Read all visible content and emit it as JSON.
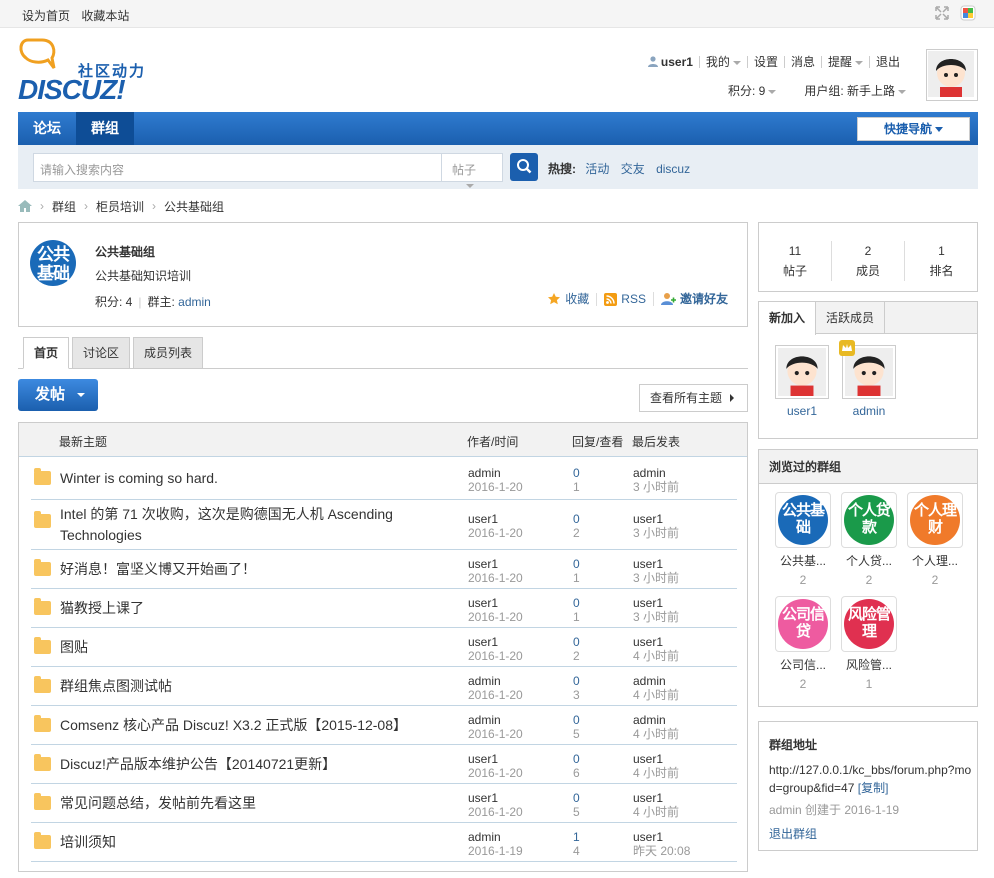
{
  "topbar": {
    "set_home": "设为首页",
    "bookmark": "收藏本站"
  },
  "logo": {
    "tagline": "社区动力",
    "brand": "DISCUZ!"
  },
  "user": {
    "name": "user1",
    "mine": "我的",
    "settings": "设置",
    "messages": "消息",
    "remind": "提醒",
    "logout": "退出",
    "points": "积分: 9",
    "usergroup": "用户组: 新手上路"
  },
  "nav": {
    "forum": "论坛",
    "group": "群组",
    "quick": "快捷导航"
  },
  "search": {
    "placeholder": "请输入搜索内容",
    "type": "帖子",
    "hot_label": "热搜:",
    "hot": [
      "活动",
      "交友",
      "discuz"
    ]
  },
  "breadcrumb": [
    "群组",
    "柜员培训",
    "公共基础组"
  ],
  "group": {
    "icon_text": "公共基础",
    "name": "公共基础组",
    "desc": "公共基础知识培训",
    "points_label": "积分: 4",
    "owner_label": "群主:",
    "owner": "admin",
    "fav": "收藏",
    "rss": "RSS",
    "invite": "邀请好友"
  },
  "tabs": [
    "首页",
    "讨论区",
    "成员列表"
  ],
  "actions": {
    "post": "发帖",
    "view_all": "查看所有主题"
  },
  "table": {
    "headers": [
      "最新主题",
      "作者/时间",
      "回复/查看",
      "最后发表"
    ],
    "rows": [
      {
        "title": "Winter is coming so hard.",
        "author": "admin",
        "date": "2016-1-20",
        "replies": "0",
        "views": "1",
        "last_user": "admin",
        "last_time": "3 小时前"
      },
      {
        "title": "Intel 的第 71 次收购，这次是购德国无人机 Ascending Technologies",
        "author": "user1",
        "date": "2016-1-20",
        "replies": "0",
        "views": "2",
        "last_user": "user1",
        "last_time": "3 小时前"
      },
      {
        "title": "好消息！富坚义博又开始画了！",
        "author": "user1",
        "date": "2016-1-20",
        "replies": "0",
        "views": "1",
        "last_user": "user1",
        "last_time": "3 小时前"
      },
      {
        "title": "猫教授上课了",
        "author": "user1",
        "date": "2016-1-20",
        "replies": "0",
        "views": "1",
        "last_user": "user1",
        "last_time": "3 小时前"
      },
      {
        "title": "图贴",
        "author": "user1",
        "date": "2016-1-20",
        "replies": "0",
        "views": "2",
        "last_user": "user1",
        "last_time": "4 小时前"
      },
      {
        "title": "群组焦点图测试帖",
        "author": "admin",
        "date": "2016-1-20",
        "replies": "0",
        "views": "3",
        "last_user": "admin",
        "last_time": "4 小时前"
      },
      {
        "title": "Comsenz 核心产品 Discuz! X3.2 正式版【2015-12-08】",
        "author": "admin",
        "date": "2016-1-20",
        "replies": "0",
        "views": "5",
        "last_user": "admin",
        "last_time": "4 小时前"
      },
      {
        "title": "Discuz!产品版本维护公告【20140721更新】",
        "author": "user1",
        "date": "2016-1-20",
        "replies": "0",
        "views": "6",
        "last_user": "user1",
        "last_time": "4 小时前"
      },
      {
        "title": "常见问题总结，发帖前先看这里",
        "author": "user1",
        "date": "2016-1-20",
        "replies": "0",
        "views": "5",
        "last_user": "user1",
        "last_time": "4 小时前"
      },
      {
        "title": "培训须知",
        "author": "admin",
        "date": "2016-1-19",
        "replies": "1",
        "views": "4",
        "last_user": "user1",
        "last_time": "昨天 20:08"
      }
    ]
  },
  "stats": [
    {
      "num": "11",
      "label": "帖子"
    },
    {
      "num": "2",
      "label": "成员"
    },
    {
      "num": "1",
      "label": "排名"
    }
  ],
  "members": {
    "tab_new": "新加入",
    "tab_active": "活跃成员",
    "list": [
      "user1",
      "admin"
    ]
  },
  "browsed": {
    "title": "浏览过的群组",
    "groups": [
      {
        "icon": "公共基础",
        "name": "公共基...",
        "count": "2",
        "color": "#1a6ab8"
      },
      {
        "icon": "个人贷款",
        "name": "个人贷...",
        "count": "2",
        "color": "#1a9a4a"
      },
      {
        "icon": "个人理财",
        "name": "个人理...",
        "count": "2",
        "color": "#f07a2a"
      },
      {
        "icon": "公司信贷",
        "name": "公司信...",
        "count": "2",
        "color": "#ee5ba0"
      },
      {
        "icon": "风险管理",
        "name": "风险管...",
        "count": "1",
        "color": "#e03050"
      }
    ]
  },
  "address": {
    "title": "群组地址",
    "url": "http://127.0.0.1/kc_bbs/forum.php?mod=group&fid=47",
    "copy": "[复制]",
    "creator": "admin 创建于 2016-1-19",
    "quit": "退出群组"
  }
}
